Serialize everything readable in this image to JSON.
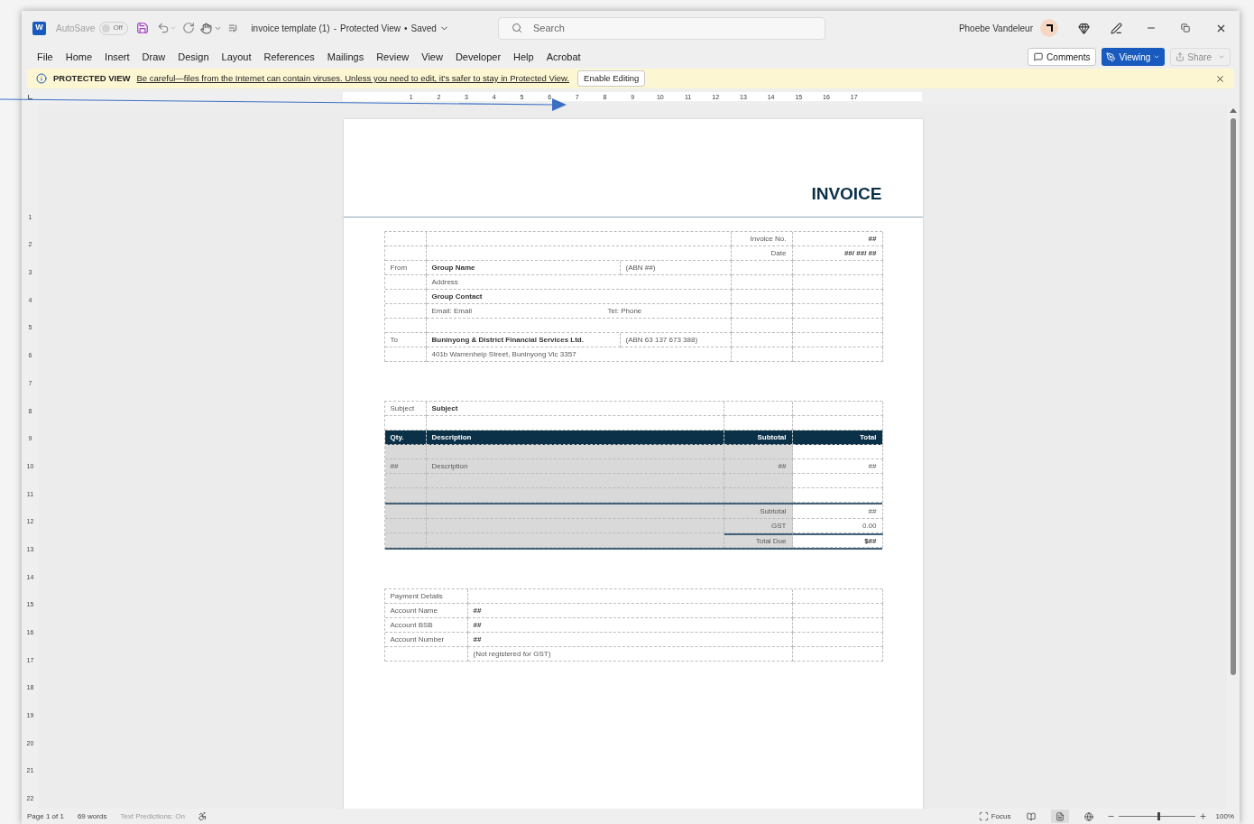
{
  "app": {
    "logo_letter": "W"
  },
  "title_bar": {
    "autosave_label": "AutoSave",
    "autosave_state": "Off",
    "autosave_on": false,
    "document_name": "invoice template (1)",
    "separator": "-",
    "view_state": "Protected View",
    "dot": "•",
    "save_state": "Saved"
  },
  "search": {
    "placeholder": "Search"
  },
  "user": {
    "name": "Phoebe Vandeleur"
  },
  "menu": [
    {
      "label": "File",
      "selected": false
    },
    {
      "label": "Home",
      "selected": false
    },
    {
      "label": "Insert",
      "selected": false
    },
    {
      "label": "Draw",
      "selected": false
    },
    {
      "label": "Design",
      "selected": false
    },
    {
      "label": "Layout",
      "selected": false
    },
    {
      "label": "References",
      "selected": false
    },
    {
      "label": "Mailings",
      "selected": false
    },
    {
      "label": "Review",
      "selected": false
    },
    {
      "label": "View",
      "selected": false
    },
    {
      "label": "Developer",
      "selected": false
    },
    {
      "label": "Help",
      "selected": false
    },
    {
      "label": "Acrobat",
      "selected": false
    }
  ],
  "actions": {
    "comments": "Comments",
    "viewing": "Viewing",
    "share": "Share",
    "share_disabled": true
  },
  "protected_view": {
    "label": "PROTECTED VIEW",
    "message": "Be careful—files from the Internet can contain viruses. Unless you need to edit, it's safer to stay in Protected View.",
    "button": "Enable Editing"
  },
  "ruler": {
    "horizontal": [
      "1",
      "2",
      "3",
      "4",
      "5",
      "6",
      "7",
      "8",
      "9",
      "10",
      "11",
      "12",
      "13",
      "14",
      "15",
      "16",
      "17"
    ],
    "vertical": [
      "1",
      "2",
      "3",
      "4",
      "5",
      "6",
      "7",
      "8",
      "9",
      "10",
      "11",
      "12",
      "13",
      "14",
      "15",
      "16",
      "17",
      "18",
      "19",
      "20",
      "21",
      "22"
    ]
  },
  "document": {
    "title": "INVOICE",
    "details_rows": [
      {
        "field": "Invoice No.",
        "value": "##"
      },
      {
        "field": "Date",
        "value": "##/ ##/ ##"
      },
      {
        "label": "From",
        "text": "Group Name",
        "bold": true,
        "note": "(ABN ##)",
        "divided": true
      },
      {
        "text": "Address",
        "bold": false
      },
      {
        "text": "Group Contact",
        "bold": true
      },
      {
        "text": "Email: Email",
        "bold": false,
        "note": "Tel:  Phone",
        "divided": false
      },
      {},
      {
        "label": "To",
        "text": "Buninyong & District Financial Services Ltd.",
        "bold": true,
        "note": "(ABN 63 137 673 388)",
        "divided": true
      },
      {
        "text": "401b Warrenheip Street, Buninyong Vic 3357",
        "bold": false
      }
    ],
    "items_table": {
      "subject_label": "Subject",
      "subject": "Subject",
      "columns": [
        "Qty.",
        "Description",
        "Subtotal",
        "Total"
      ],
      "rows": [
        {},
        {
          "qty": "##",
          "description": "Description",
          "subtotal": "##",
          "total": "##"
        },
        {},
        {}
      ],
      "totals": [
        {
          "label": "Subtotal",
          "value": "##",
          "kind": "plain"
        },
        {
          "label": "GST",
          "value": "0.00",
          "kind": "plain"
        },
        {
          "label": "Total Due",
          "value": "$##",
          "kind": "due"
        }
      ]
    },
    "payment_rows": [
      {
        "label": "Payment Details"
      },
      {
        "label": "Account Name",
        "value": "##",
        "bold": true
      },
      {
        "label": "Account BSB",
        "value": "##",
        "bold": true
      },
      {
        "label": "Account Number",
        "value": "##",
        "bold": true
      },
      {
        "value": "(Not registered for GST)",
        "bold": false
      }
    ]
  },
  "status_bar": {
    "page": "Page 1 of 1",
    "words": "69 words",
    "predictions": "Text Predictions: On",
    "focus": "Focus",
    "views": [
      {
        "kind": "read",
        "selected": false
      },
      {
        "kind": "print",
        "selected": true
      },
      {
        "kind": "web",
        "selected": false
      }
    ],
    "zoom_slider": {
      "level": 0.53
    },
    "zoom": "100%"
  }
}
